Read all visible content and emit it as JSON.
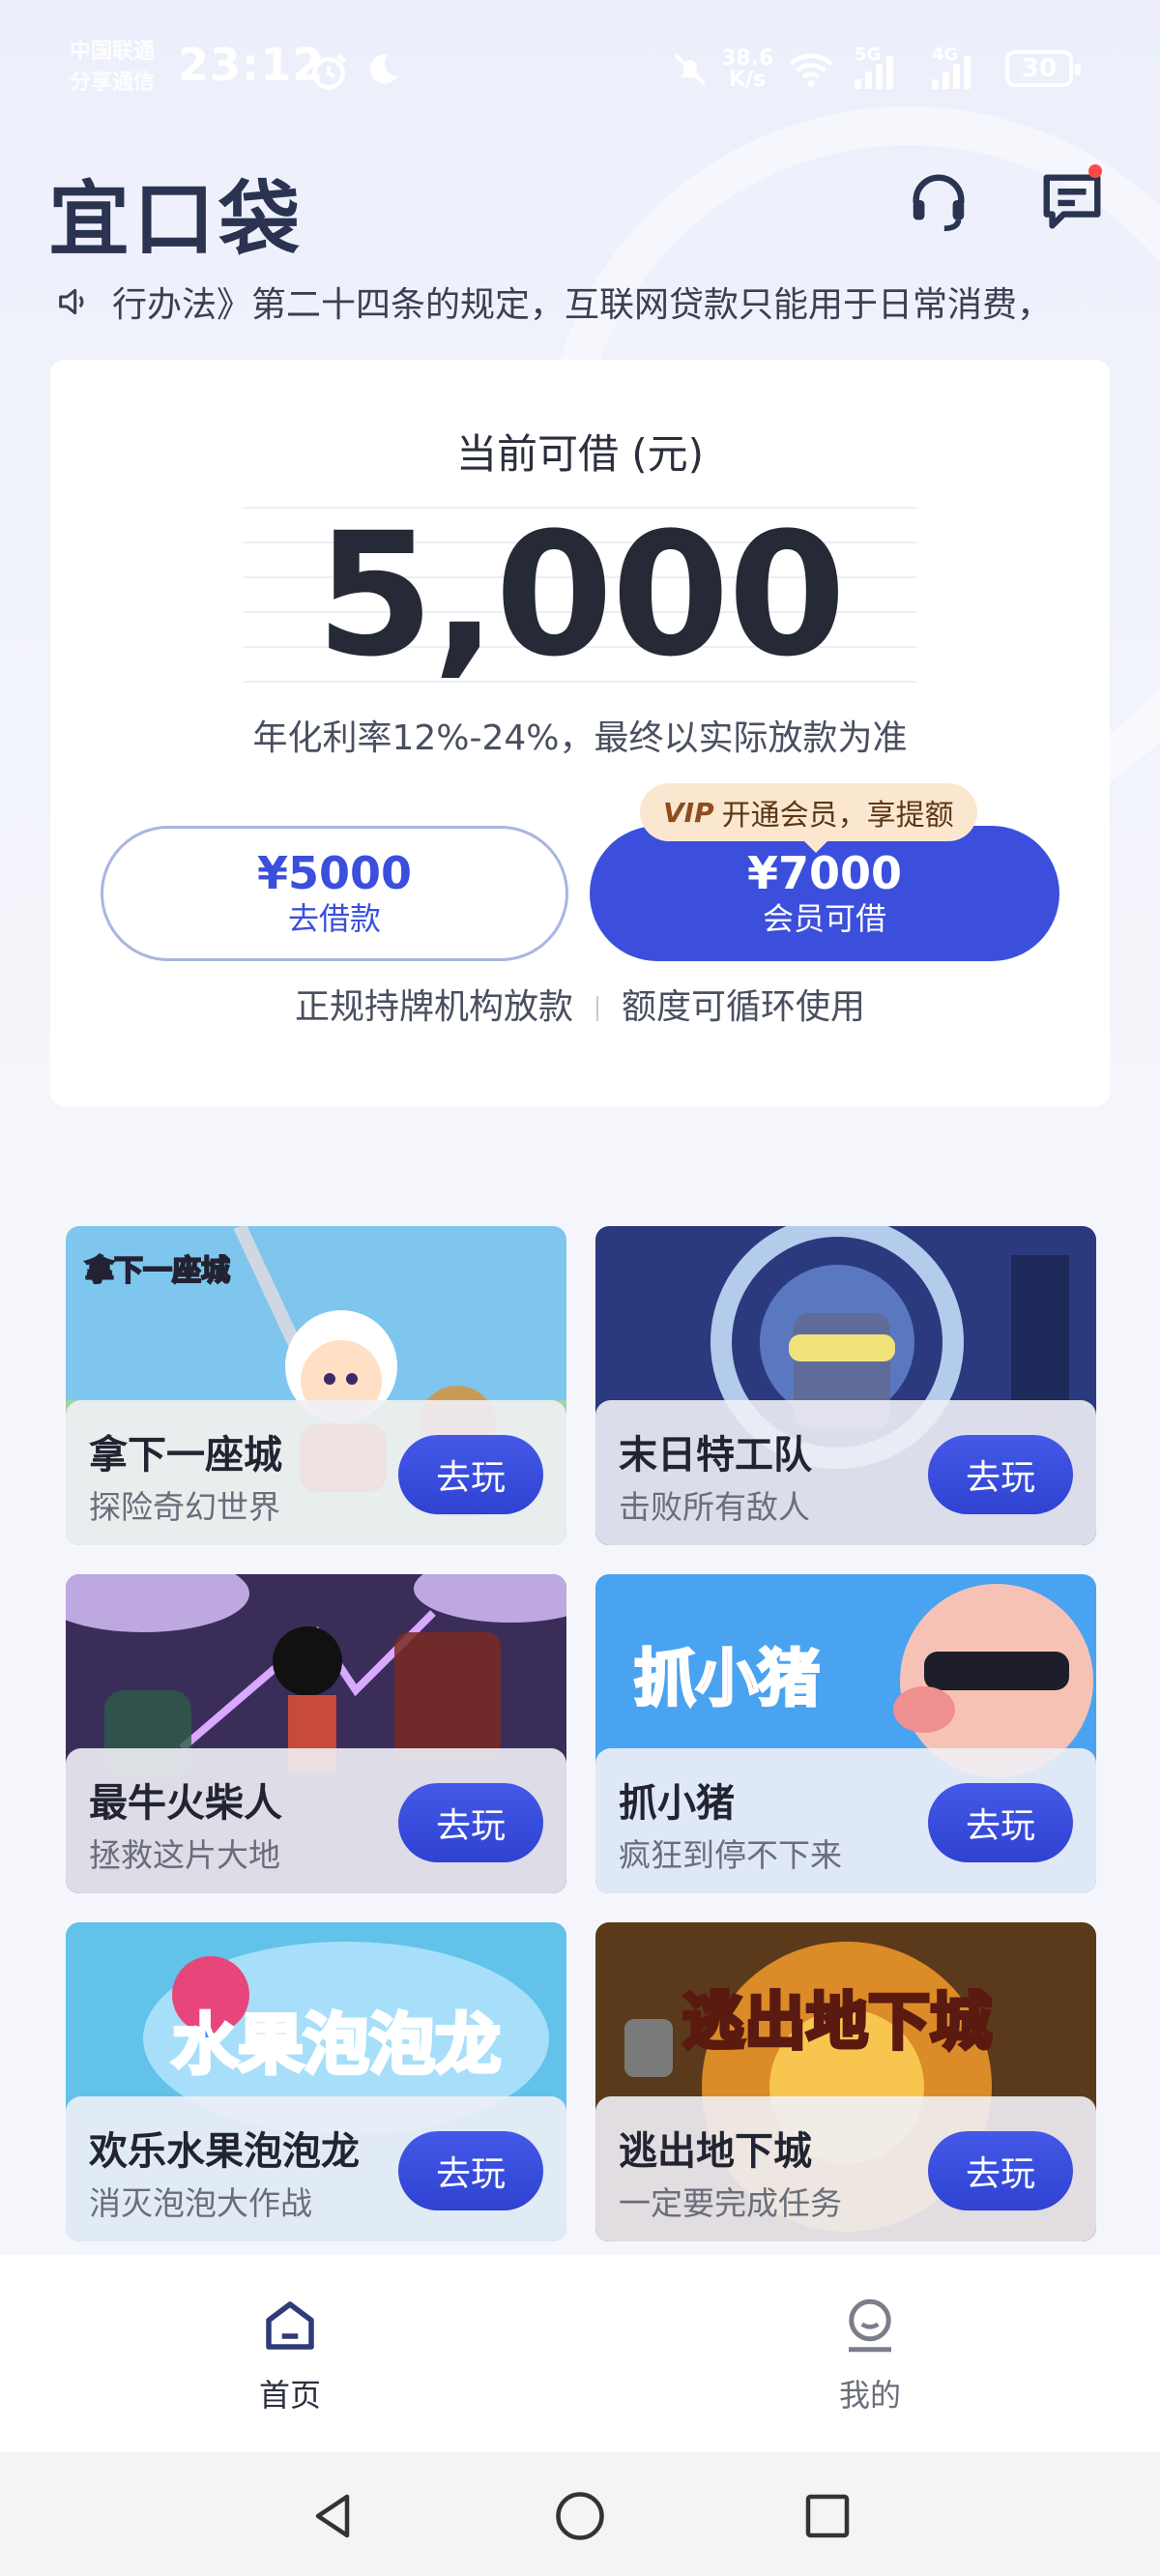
{
  "status_bar": {
    "carrier_line1": "中国联通",
    "carrier_line2": "分享通信",
    "time": "23:12",
    "net_speed_value": "38.6",
    "net_speed_unit": "K/s",
    "signal_label_1": "5G",
    "signal_label_2": "4G",
    "battery": "30"
  },
  "header": {
    "logo": "宜口袋",
    "support_icon": "headset-icon",
    "message_icon": "message-icon"
  },
  "notice": {
    "text": "行办法》第二十四条的规定，互联网贷款只能用于日常消费，"
  },
  "credit": {
    "title": "当前可借 (元)",
    "amount": "5,000",
    "rate_text": "年化利率12%-24%，最终以实际放款为准",
    "borrow_amount": "¥5000",
    "borrow_label": "去借款",
    "member_amount": "¥7000",
    "member_label": "会员可借",
    "vip_badge": "VIP",
    "vip_tip": "开通会员，享提额",
    "footer_left": "正规持牌机构放款",
    "footer_right": "额度可循环使用"
  },
  "games": [
    {
      "name": "拿下一座城",
      "desc": "探险奇幻世界",
      "button": "去玩",
      "art_title": "拿下一座城"
    },
    {
      "name": "末日特工队",
      "desc": "击败所有敌人",
      "button": "去玩"
    },
    {
      "name": "最牛火柴人",
      "desc": "拯救这片大地",
      "button": "去玩"
    },
    {
      "name": "抓小猪",
      "desc": "疯狂到停不下来",
      "button": "去玩",
      "art_title": "抓小猪"
    },
    {
      "name": "欢乐水果泡泡龙",
      "desc": "消灭泡泡大作战",
      "button": "去玩",
      "art_title": "水果泡泡龙"
    },
    {
      "name": "逃出地下城",
      "desc": "一定要完成任务",
      "button": "去玩",
      "art_title": "逃出地下城"
    }
  ],
  "tabbar": {
    "home": "首页",
    "mine": "我的"
  },
  "colors": {
    "primary": "#3b4fdc",
    "text_dark": "#262a36",
    "vip_bg": "#fbe7cf"
  }
}
